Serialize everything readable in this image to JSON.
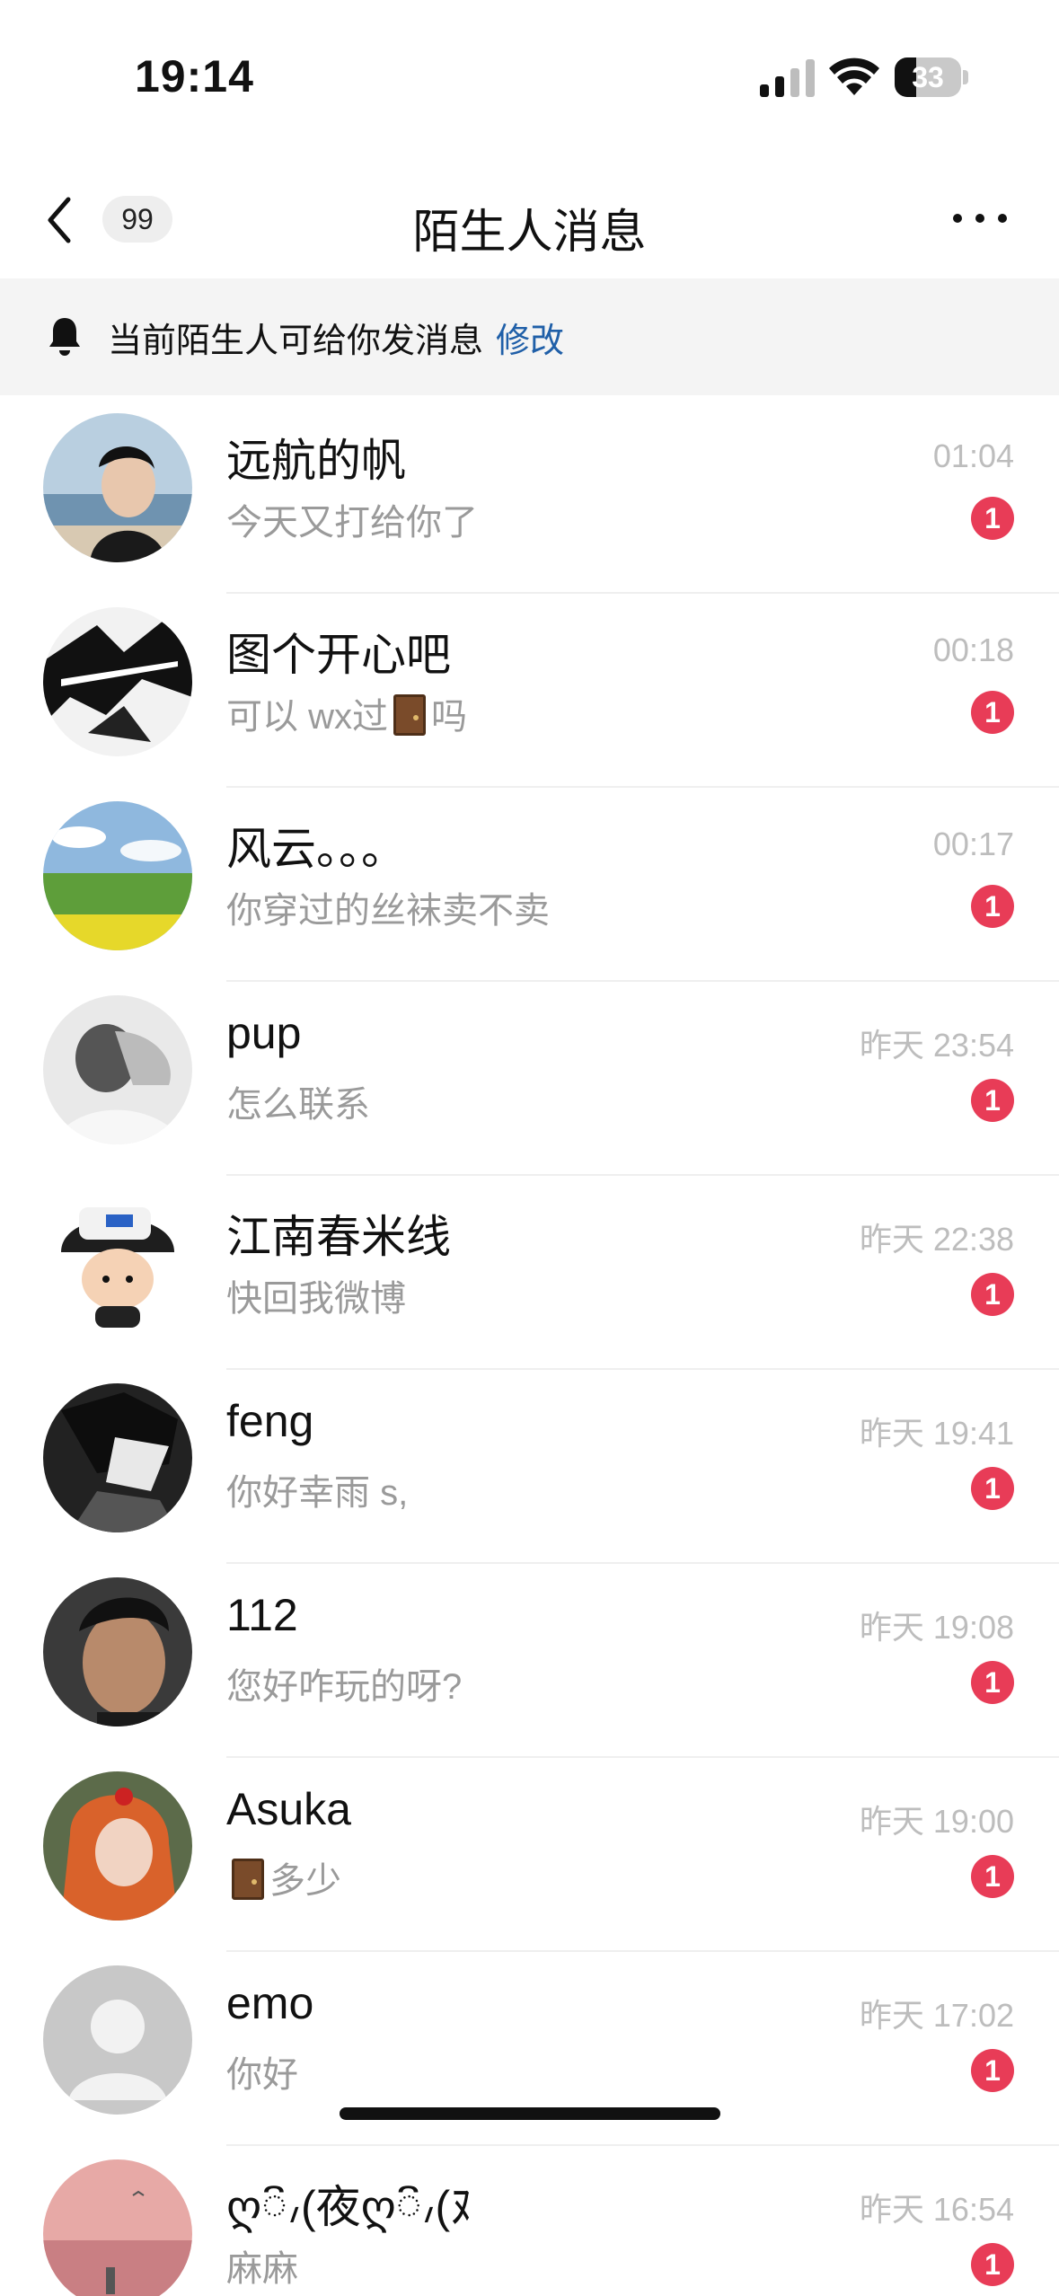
{
  "status_bar": {
    "time": "19:14",
    "battery": "33",
    "battery_level": 0.33
  },
  "nav": {
    "badge": "99",
    "title": "陌生人消息"
  },
  "banner": {
    "text": "当前陌生人可给你发消息",
    "link": "修改"
  },
  "conversations": [
    {
      "name": "远航的帆",
      "time": "01:04",
      "preview": "今天又打给你了",
      "unread": "1"
    },
    {
      "name": "图个开心吧",
      "time": "00:18",
      "preview_before": "可以 wx过",
      "preview_after": "吗",
      "unread": "1"
    },
    {
      "name": "风云。。。",
      "time": "00:17",
      "preview": "你穿过的丝袜卖不卖",
      "unread": "1"
    },
    {
      "name": "pup",
      "time": "昨天 23:54",
      "preview": "怎么联系",
      "unread": "1"
    },
    {
      "name": "江南春米线",
      "time": "昨天 22:38",
      "preview": "快回我微博",
      "unread": "1"
    },
    {
      "name": "feng",
      "time": "昨天 19:41",
      "preview": "你好幸雨 s,",
      "unread": "1"
    },
    {
      "name": "112",
      "time": "昨天 19:08",
      "preview": "您好咋玩的呀?",
      "unread": "1"
    },
    {
      "name": "Asuka",
      "time": "昨天 19:00",
      "preview_after": "多少",
      "unread": "1"
    },
    {
      "name": "emo",
      "time": "昨天 17:02",
      "preview": "你好",
      "unread": "1"
    },
    {
      "name": "ღ៝៸(夜ღ៝៸(ﾇ",
      "time": "昨天 16:54",
      "preview": "麻麻",
      "unread": "1"
    }
  ],
  "colors": {
    "unread_badge": "#e83c57",
    "link": "#1f5fa8",
    "banner_bg": "#f4f4f4"
  }
}
